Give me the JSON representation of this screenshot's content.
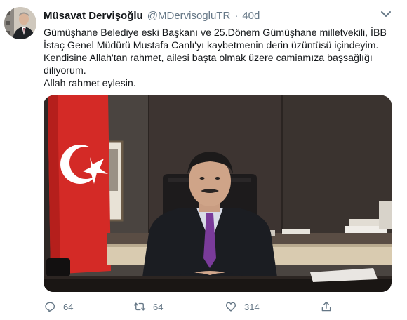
{
  "tweet": {
    "author": {
      "name": "Müsavat Dervişoğlu",
      "handle": "@MDervisogluTR",
      "separator": "·",
      "time": "40d"
    },
    "text_lines": [
      "Gümüşhane Belediye eski Başkanı ve 25.Dönem Gümüşhane milletvekili, İBB",
      "İstaç Genel Müdürü Mustafa Canlı'yı kaybetmenin derin üzüntüsü içindeyim.",
      "Kendisine Allah'tan rahmet, ailesi başta olmak üzere camiamıza başsağlığı",
      "diliyorum.",
      "Allah rahmet eylesin."
    ],
    "media": {
      "kind": "photo"
    },
    "actions": {
      "replies": "64",
      "retweets": "64",
      "likes": "314"
    },
    "icons": {
      "reply": "reply-icon",
      "retweet": "retweet-icon",
      "like": "heart-icon",
      "share": "share-icon",
      "more": "chevron-down-icon"
    },
    "colors": {
      "text": "#14171a",
      "muted": "#657786"
    }
  }
}
